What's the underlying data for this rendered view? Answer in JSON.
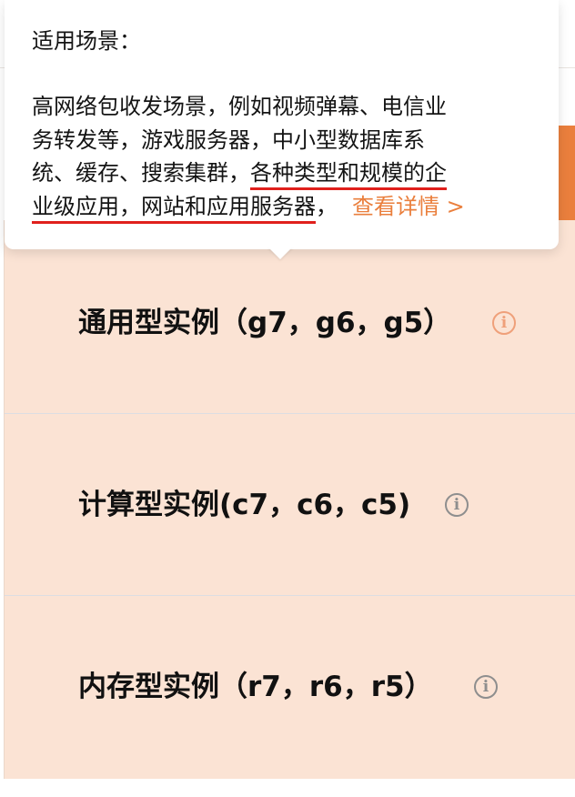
{
  "tooltip": {
    "heading": "适用场景：",
    "lines": [
      "高网络包收发场景，例如视频弹幕、电信业",
      "务转发等，游戏服务器，中小型数据库系",
      "统、缓存、搜索集群，",
      "各种类型和规模的企",
      "业级应用，网站和应用服务器",
      "，",
      "查看详情 >"
    ]
  },
  "instances": [
    {
      "label": "通用型实例（g7，g6，g5）",
      "info_icon": "info-circle-icon",
      "active": true
    },
    {
      "label": "计算型实例(c7，c6，c5)",
      "info_icon": "info-circle-icon",
      "active": false
    },
    {
      "label": "内存型实例（r7，r6，r5）",
      "info_icon": "info-circle-icon",
      "active": false
    }
  ],
  "colors": {
    "accent": "#ea7f3d",
    "panel_bg": "#fbe3d4",
    "underline": "#e0201c",
    "active_icon": "#efa07a",
    "inactive_icon": "#8e8e8e"
  }
}
